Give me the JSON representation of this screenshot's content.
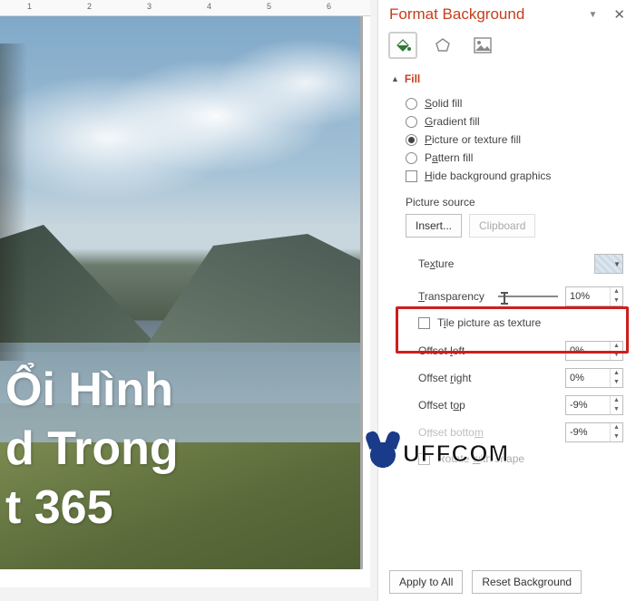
{
  "ruler": {
    "marks": [
      "1",
      "2",
      "3",
      "4",
      "5",
      "6"
    ]
  },
  "slide": {
    "line1": "Ổi Hình",
    "line2": "d Trong",
    "line3": "t 365"
  },
  "watermark": "UFFCOM",
  "pane": {
    "title": "Format Background",
    "section_fill": "Fill",
    "fill_options": {
      "solid": "Solid fill",
      "gradient": "Gradient fill",
      "picture": "Picture or texture fill",
      "pattern": "Pattern fill",
      "hide_bg": "Hide background graphics"
    },
    "picture_source_label": "Picture source",
    "insert_btn": "Insert...",
    "clipboard_btn": "Clipboard",
    "texture_label": "Texture",
    "transparency_label": "Transparency",
    "transparency_value": "10%",
    "tile_label": "Tile picture as texture",
    "offset_left": "Offset left",
    "offset_left_val": "0%",
    "offset_right": "Offset right",
    "offset_right_val": "0%",
    "offset_top": "Offset top",
    "offset_top_val": "-9%",
    "offset_bottom": "Offset bottom",
    "offset_bottom_val": "-9%",
    "rotate_label": "Rotate with shape",
    "apply_all": "Apply to All",
    "reset_bg": "Reset Background"
  }
}
